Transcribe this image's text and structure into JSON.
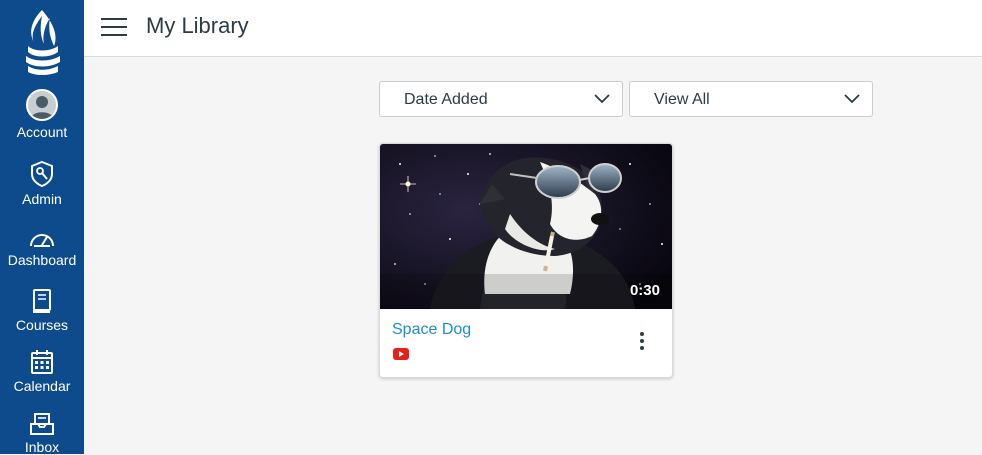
{
  "nav": {
    "items": [
      {
        "label": "Account",
        "icon": "avatar"
      },
      {
        "label": "Admin",
        "icon": "shield-icon"
      },
      {
        "label": "Dashboard",
        "icon": "speedometer-icon"
      },
      {
        "label": "Courses",
        "icon": "book-icon"
      },
      {
        "label": "Calendar",
        "icon": "calendar-icon"
      },
      {
        "label": "Inbox",
        "icon": "inbox-icon"
      }
    ]
  },
  "header": {
    "title": "My Library"
  },
  "filters": {
    "sort_value": "Date Added",
    "view_value": "View All"
  },
  "videos": [
    {
      "title": "Space Dog",
      "duration": "0:30",
      "source_icon": "youtube-icon"
    }
  ],
  "colors": {
    "nav_bg": "#0d4b8c",
    "link": "#1a8fd4",
    "youtube": "#e62117"
  }
}
